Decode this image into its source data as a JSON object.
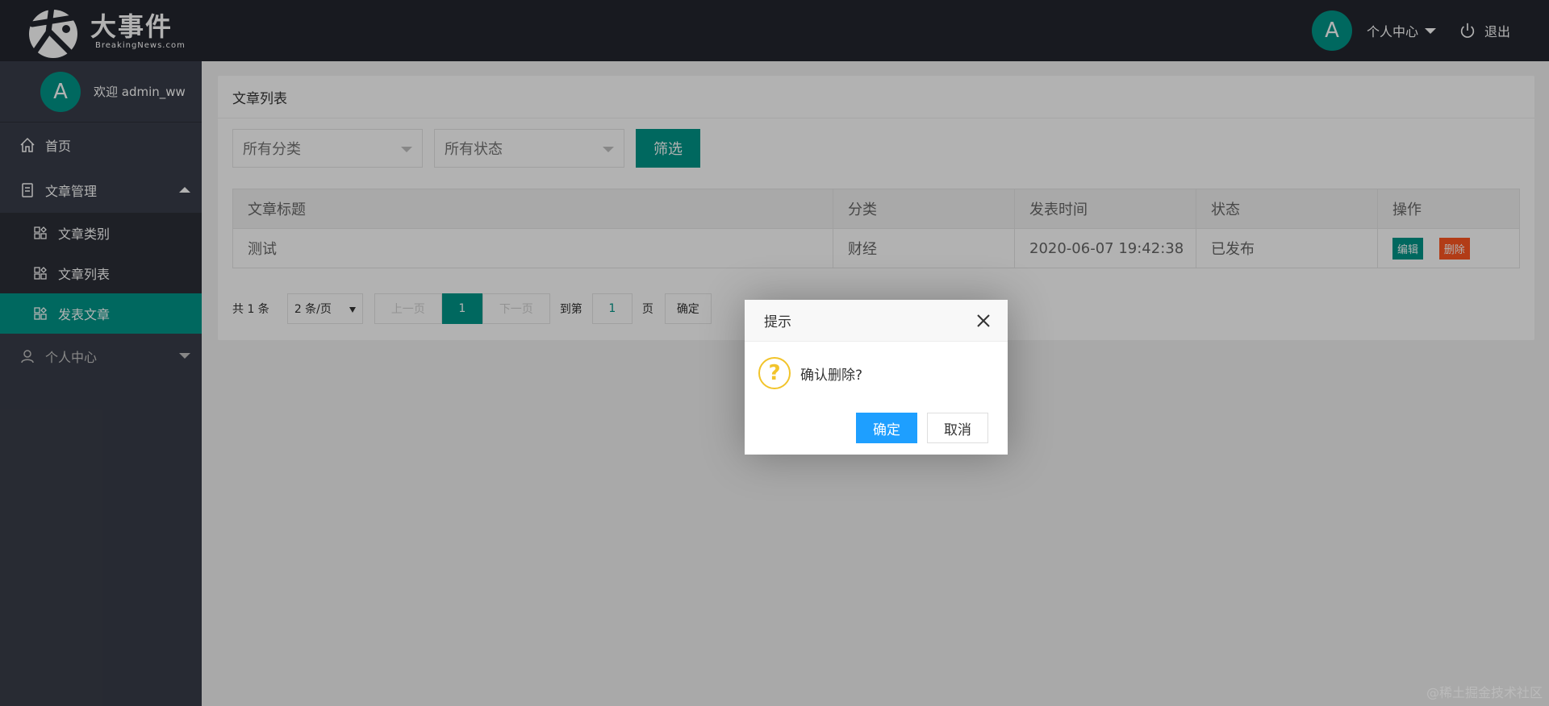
{
  "header": {
    "logo_title": "大事件",
    "logo_sub": "BreakingNews.com",
    "avatar_letter": "A",
    "user_menu": "个人中心",
    "logout": "退出"
  },
  "sidebar": {
    "avatar_letter": "A",
    "welcome": "欢迎 admin_ww",
    "items": [
      {
        "label": "首页"
      },
      {
        "label": "文章管理"
      },
      {
        "label": "个人中心"
      }
    ],
    "sub_items": [
      {
        "label": "文章类别"
      },
      {
        "label": "文章列表"
      },
      {
        "label": "发表文章"
      }
    ]
  },
  "main": {
    "card_title": "文章列表",
    "filter": {
      "category_placeholder": "所有分类",
      "status_placeholder": "所有状态",
      "button": "筛选"
    },
    "table": {
      "headers": [
        "文章标题",
        "分类",
        "发表时间",
        "状态",
        "操作"
      ],
      "rows": [
        {
          "title": "测试",
          "category": "财经",
          "time": "2020-06-07 19:42:38",
          "status": "已发布",
          "edit": "编辑",
          "delete": "删除"
        }
      ]
    },
    "pager": {
      "count": "共 1 条",
      "limit": "2 条/页",
      "prev": "上一页",
      "current": "1",
      "next": "下一页",
      "goto_label": "到第",
      "goto_value": "1",
      "page_unit": "页",
      "go_button": "确定"
    }
  },
  "dialog": {
    "title": "提示",
    "message": "确认删除?",
    "ok": "确定",
    "cancel": "取消"
  },
  "watermark": "@稀土掘金技术社区",
  "colors": {
    "header_bg": "#23262e",
    "sidebar_bg": "#393d49",
    "accent": "#009688",
    "danger": "#ff5722",
    "primary_btn": "#1e9fff"
  }
}
